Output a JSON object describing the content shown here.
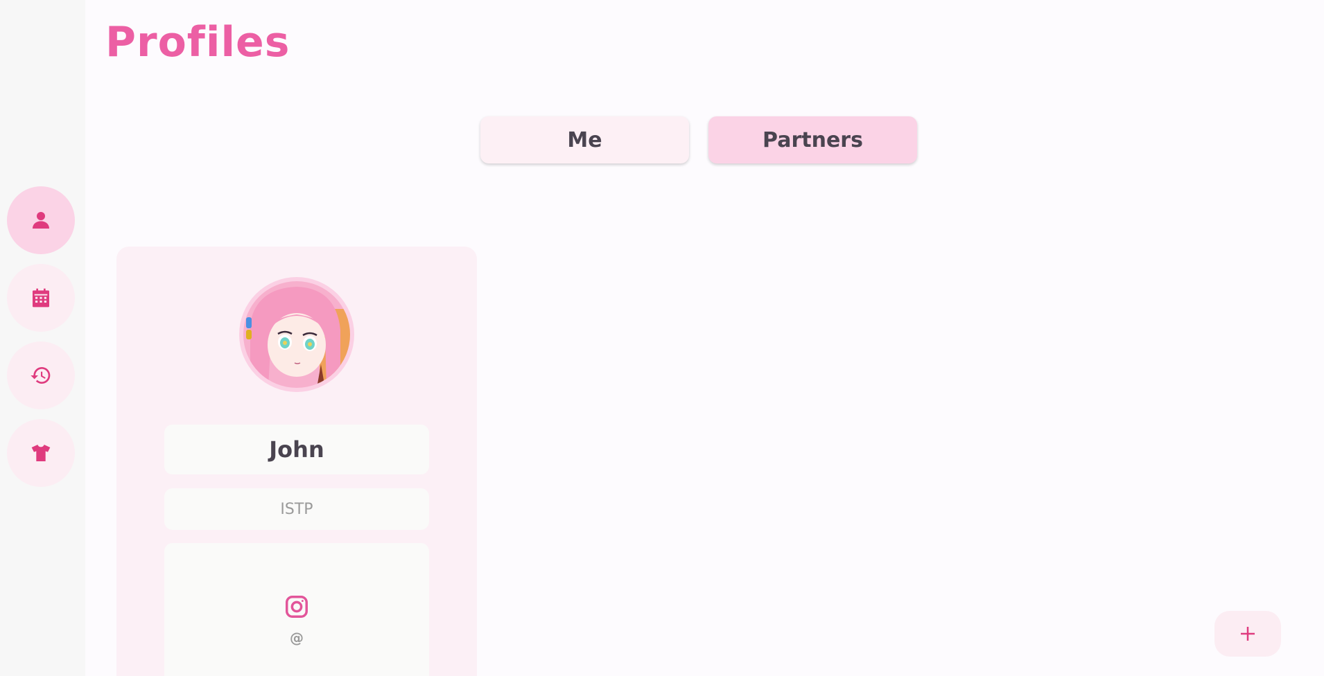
{
  "page": {
    "title": "Profiles"
  },
  "tabs": [
    {
      "label": "Me",
      "selected": false
    },
    {
      "label": "Partners",
      "selected": true
    }
  ],
  "sidebar": {
    "items": [
      {
        "icon": "person-icon",
        "active": true
      },
      {
        "icon": "calendar-icon",
        "active": false
      },
      {
        "icon": "history-icon",
        "active": false
      },
      {
        "icon": "tshirt-icon",
        "active": false
      }
    ]
  },
  "profile": {
    "name": "John",
    "mbti": "ISTP",
    "social_icon": "instagram-icon",
    "handle": "@"
  },
  "fab": {
    "icon": "plus-icon"
  },
  "colors": {
    "accent": "#ec5fa4",
    "icon": "#df3b7e",
    "selected_bg": "#fbd3e6",
    "card_bg": "#fcf0f6"
  }
}
